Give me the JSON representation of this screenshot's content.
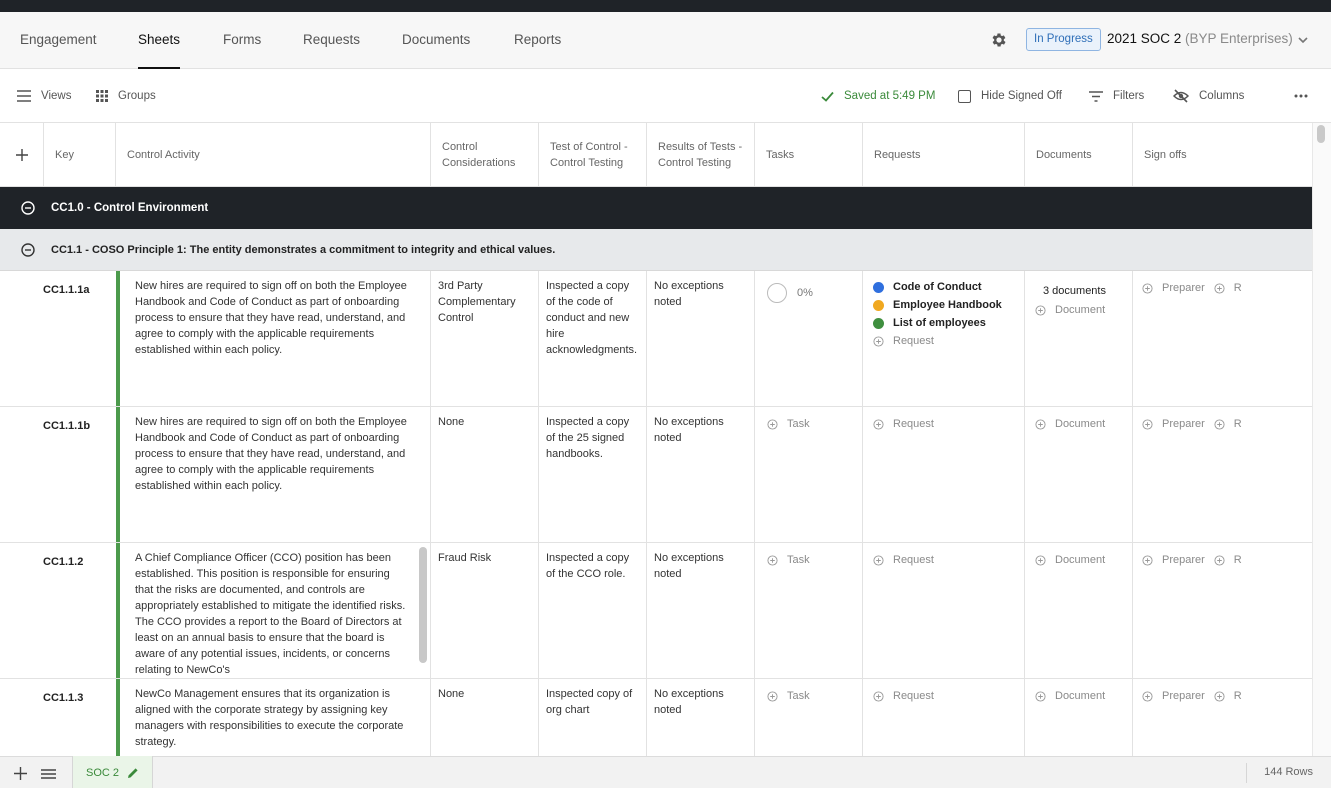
{
  "nav": {
    "tabs": [
      {
        "label": "Engagement"
      },
      {
        "label": "Sheets"
      },
      {
        "label": "Forms"
      },
      {
        "label": "Requests"
      },
      {
        "label": "Documents"
      },
      {
        "label": "Reports"
      }
    ],
    "active_tab": "Sheets",
    "status": "In Progress",
    "engagement_name": "2021 SOC 2",
    "engagement_client": "(BYP Enterprises)"
  },
  "toolbar": {
    "views_label": "Views",
    "groups_label": "Groups",
    "saved_label": "Saved at 5:49 PM",
    "hide_signed_off_label": "Hide Signed Off",
    "filters_label": "Filters",
    "columns_label": "Columns"
  },
  "columns": {
    "add": "+",
    "key": "Key",
    "activity": "Control Activity",
    "consid": "Control Considerations",
    "test": "Test of Control - Control Testing",
    "results": "Results of Tests - Control Testing",
    "tasks": "Tasks",
    "requests": "Requests",
    "documents": "Documents",
    "signoffs": "Sign offs"
  },
  "groups": {
    "section": "CC1.0 - Control Environment",
    "subsection": "CC1.1 - COSO Principle 1: The entity demonstrates a commitment to integrity and ethical values."
  },
  "rows": [
    {
      "key": "CC1.1.1a",
      "activity": "New hires are required to sign off on both the Employee Handbook and Code of Conduct as part of onboarding process to ensure that they have read, understand, and agree to comply with the applicable requirements established within each policy.",
      "consid": "3rd Party Complementary Control",
      "test": "Inspected a copy of the code of conduct and new hire acknowledgments.",
      "results": "No exceptions noted",
      "task_progress": "0%",
      "requests": [
        {
          "label": "Code of Conduct",
          "color": "#2f6fde"
        },
        {
          "label": "Employee Handbook",
          "color": "#f0a820"
        },
        {
          "label": "List of employees",
          "color": "#3f8f3f"
        }
      ],
      "add_request": "Request",
      "doc_count": "3 documents",
      "add_document": "Document",
      "preparer": "Preparer",
      "reviewer": "R"
    },
    {
      "key": "CC1.1.1b",
      "activity": "New hires are required to sign off on both the Employee Handbook and Code of Conduct as part of onboarding process to ensure that they have read, understand, and agree to comply with the applicable requirements established within each policy.",
      "consid": "None",
      "test": "Inspected a copy of the 25 signed handbooks.",
      "results": "No exceptions noted",
      "add_task": "Task",
      "add_request": "Request",
      "add_document": "Document",
      "preparer": "Preparer",
      "reviewer": "R"
    },
    {
      "key": "CC1.1.2",
      "activity": "A Chief Compliance Officer (CCO) position has been established. This position is responsible for ensuring that the risks are documented, and controls are appropriately established to mitigate the identified risks. The CCO provides a report to the Board of Directors at least on an annual basis to ensure that the board is aware of any potential issues, incidents, or concerns relating to NewCo's",
      "consid": "Fraud Risk",
      "test": "Inspected a copy of the CCO role.",
      "results": "No exceptions noted",
      "add_task": "Task",
      "add_request": "Request",
      "add_document": "Document",
      "preparer": "Preparer",
      "reviewer": "R"
    },
    {
      "key": "CC1.1.3",
      "activity": "NewCo Management ensures that its organization is aligned with the corporate strategy by assigning key managers with responsibilities to execute the corporate strategy.",
      "consid": "None",
      "test": "Inspected copy of org chart",
      "results": "No exceptions noted",
      "add_task": "Task",
      "add_request": "Request",
      "add_document": "Document",
      "preparer": "Preparer",
      "reviewer": "R"
    }
  ],
  "footer": {
    "sheet_name": "SOC 2",
    "row_count": "144 Rows"
  },
  "colors": {
    "accent_green": "#4c9a4c",
    "dark_header": "#1f2328",
    "status_blue": "#2f6fb8"
  }
}
